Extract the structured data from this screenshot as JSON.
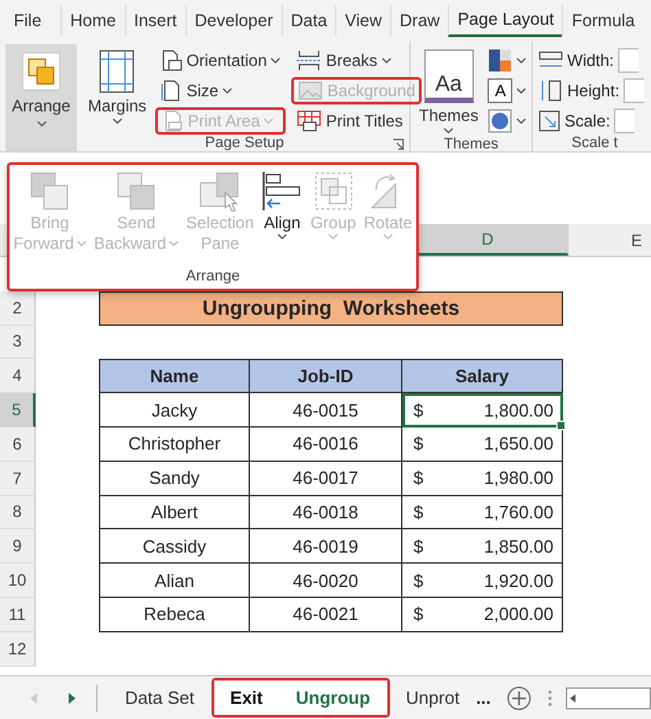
{
  "ribbon_tabs": [
    {
      "label": "File",
      "selected": false
    },
    {
      "label": "Home",
      "selected": false
    },
    {
      "label": "Insert",
      "selected": false
    },
    {
      "label": "Developer",
      "selected": false
    },
    {
      "label": "Data",
      "selected": false
    },
    {
      "label": "View",
      "selected": false
    },
    {
      "label": "Draw",
      "selected": false
    },
    {
      "label": "Page Layout",
      "selected": true
    },
    {
      "label": "Formula",
      "selected": false
    }
  ],
  "arrange_button": {
    "label": "Arrange",
    "pressed": true
  },
  "page_setup": {
    "label": "Page Setup",
    "margins": {
      "label": "Margins"
    },
    "columns": [
      [
        {
          "label": "Orientation",
          "kind": "orientation",
          "dropdown": true,
          "disabled": false,
          "highlighted": false
        },
        {
          "label": "Size",
          "kind": "size",
          "dropdown": true,
          "disabled": false,
          "highlighted": false
        },
        {
          "label": "Print Area",
          "kind": "printarea",
          "dropdown": true,
          "disabled": true,
          "highlighted": true
        }
      ],
      [
        {
          "label": "Breaks",
          "kind": "breaks",
          "dropdown": true,
          "disabled": false,
          "highlighted": false
        },
        {
          "label": "Background",
          "kind": "background",
          "dropdown": false,
          "disabled": true,
          "highlighted": true
        },
        {
          "label": "Print Titles",
          "kind": "titles",
          "dropdown": false,
          "disabled": false,
          "highlighted": false
        }
      ]
    ]
  },
  "themes": {
    "label": "Themes",
    "button": {
      "label": "Themes",
      "glyph": "Aa"
    },
    "options": [
      {
        "kind": "colors"
      },
      {
        "kind": "fonts",
        "glyph": "A"
      },
      {
        "kind": "effects"
      }
    ]
  },
  "scale_to_fit": {
    "label": "Scale t",
    "fields": [
      {
        "label": "Width:",
        "kind": "width"
      },
      {
        "label": "Height:",
        "kind": "height"
      },
      {
        "label": "Scale:",
        "kind": "scale"
      }
    ]
  },
  "arrange_panel": {
    "label": "Arrange",
    "highlighted": true,
    "buttons": [
      {
        "lines": [
          "Bring",
          "Forward"
        ],
        "kind": "forward",
        "dropdown": true,
        "disabled": true
      },
      {
        "lines": [
          "Send",
          "Backward"
        ],
        "kind": "backward",
        "dropdown": true,
        "disabled": true
      },
      {
        "lines": [
          "Selection",
          "Pane"
        ],
        "kind": "pane",
        "dropdown": false,
        "disabled": true
      },
      {
        "lines": [
          "Align"
        ],
        "kind": "align",
        "dropdown": true,
        "disabled": false
      },
      {
        "lines": [
          "Group"
        ],
        "kind": "group",
        "dropdown": true,
        "disabled": true
      },
      {
        "lines": [
          "Rotate"
        ],
        "kind": "rotate",
        "dropdown": true,
        "disabled": true
      }
    ]
  },
  "sheet": {
    "column_headers": [
      {
        "label": "D",
        "selected": true
      },
      {
        "label": "E",
        "selected": false
      }
    ],
    "row_numbers": [
      {
        "label": "2",
        "selected": false
      },
      {
        "label": "3",
        "selected": false
      },
      {
        "label": "4",
        "selected": false
      },
      {
        "label": "5",
        "selected": true
      },
      {
        "label": "6",
        "selected": false
      },
      {
        "label": "7",
        "selected": false
      },
      {
        "label": "8",
        "selected": false
      },
      {
        "label": "9",
        "selected": false
      },
      {
        "label": "10",
        "selected": false
      },
      {
        "label": "11",
        "selected": false
      },
      {
        "label": "12",
        "selected": false
      }
    ],
    "title": "Ungroupping  Worksheets",
    "table": {
      "columns": [
        "Name",
        "Job-ID",
        "Salary"
      ],
      "rows": [
        {
          "name": "Jacky",
          "job_id": "46-0015",
          "currency": "$",
          "salary": "1,800.00",
          "selected": true
        },
        {
          "name": "Christopher",
          "job_id": "46-0016",
          "currency": "$",
          "salary": "1,650.00",
          "selected": false
        },
        {
          "name": "Sandy",
          "job_id": "46-0017",
          "currency": "$",
          "salary": "1,980.00",
          "selected": false
        },
        {
          "name": "Albert",
          "job_id": "46-0018",
          "currency": "$",
          "salary": "1,760.00",
          "selected": false
        },
        {
          "name": "Cassidy",
          "job_id": "46-0019",
          "currency": "$",
          "salary": "1,850.00",
          "selected": false
        },
        {
          "name": "Alian",
          "job_id": "46-0020",
          "currency": "$",
          "salary": "1,920.00",
          "selected": false
        },
        {
          "name": "Rebeca",
          "job_id": "46-0021",
          "currency": "$",
          "salary": "2,000.00",
          "selected": false
        }
      ]
    }
  },
  "sheet_tabs": {
    "tabs": [
      {
        "label": "Data Set",
        "selected": false,
        "active": false,
        "highlighted": false
      },
      {
        "label": "Exit",
        "selected": true,
        "active": true,
        "highlighted": true
      },
      {
        "label": "Ungroup",
        "selected": true,
        "active": false,
        "highlighted": true
      },
      {
        "label": "Unprot",
        "selected": false,
        "active": false,
        "highlighted": false
      }
    ],
    "more": "..."
  }
}
